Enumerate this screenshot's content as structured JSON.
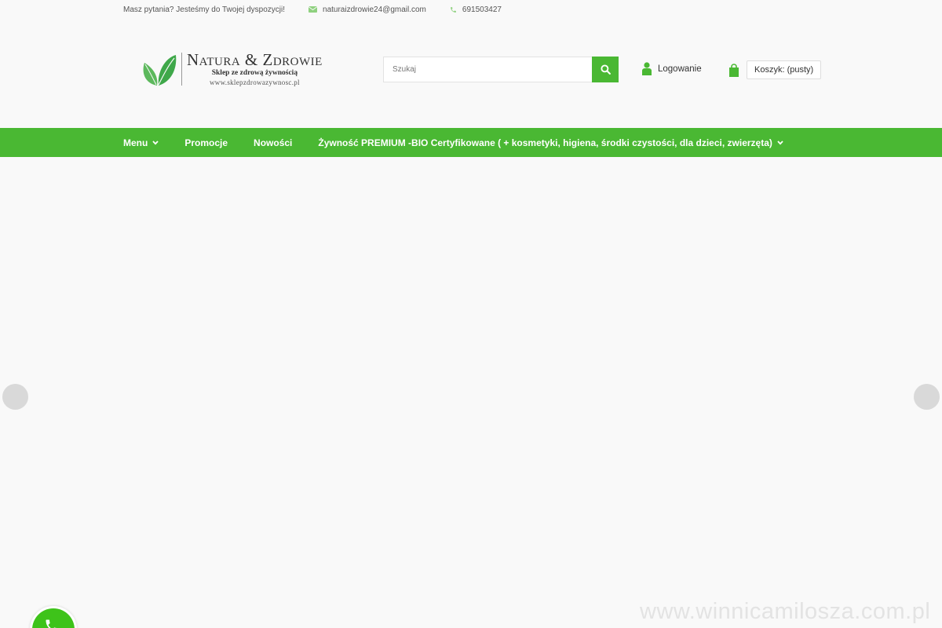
{
  "topbar": {
    "question": "Masz pytania? Jesteśmy do Twojej dyspozycji!",
    "email": "naturaizdrowie24@gmail.com",
    "phone": "691503427",
    "icons": {
      "email": "envelope-icon",
      "phone": "phone-icon"
    }
  },
  "logo": {
    "brand": "Natura & Zdrowie",
    "tagline": "Sklep ze zdrową żywnością",
    "url": "www.sklepzdrowazywnosc.pl",
    "icon": "leaves-logo-icon"
  },
  "search": {
    "placeholder": "Szukaj",
    "icon": "search-icon"
  },
  "account": {
    "login_label": "Logowanie",
    "icon": "user-icon"
  },
  "cart": {
    "label": "Koszyk: (pusty)",
    "icon": "shopping-bag-icon"
  },
  "nav": {
    "items": [
      {
        "label": "Menu",
        "has_dropdown": true
      },
      {
        "label": "Promocje",
        "has_dropdown": false
      },
      {
        "label": "Nowości",
        "has_dropdown": false
      },
      {
        "label": "Żywność PREMIUM -BIO Certyfikowane ( + kosmetyki, higiena, środki czystości, dla dzieci, zwierzęta)",
        "has_dropdown": true
      }
    ]
  },
  "slider": {
    "prev_icon": "slider-prev-icon",
    "next_icon": "slider-next-icon"
  },
  "chat": {
    "icon": "phone-chat-icon"
  },
  "watermark": "www.winnicamilosza.com.pl",
  "colors": {
    "accent": "#4ab833",
    "background": "#f9f9f9",
    "chat": "#3ec31a"
  }
}
